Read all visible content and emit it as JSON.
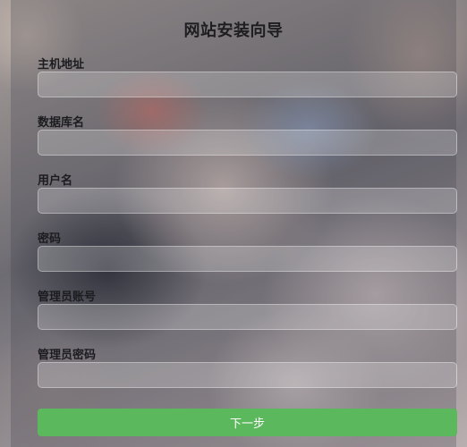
{
  "form": {
    "title": "网站安装向导",
    "fields": [
      {
        "label": "主机地址",
        "value": "",
        "placeholder": ""
      },
      {
        "label": "数据库名",
        "value": "",
        "placeholder": ""
      },
      {
        "label": "用户名",
        "value": "",
        "placeholder": ""
      },
      {
        "label": "密码",
        "value": "",
        "placeholder": ""
      },
      {
        "label": "管理员账号",
        "value": "",
        "placeholder": ""
      },
      {
        "label": "管理员密码",
        "value": "",
        "placeholder": ""
      }
    ],
    "submit_label": "下一步"
  },
  "colors": {
    "accent": "#5cb85c",
    "title_text": "#1e1e22"
  }
}
